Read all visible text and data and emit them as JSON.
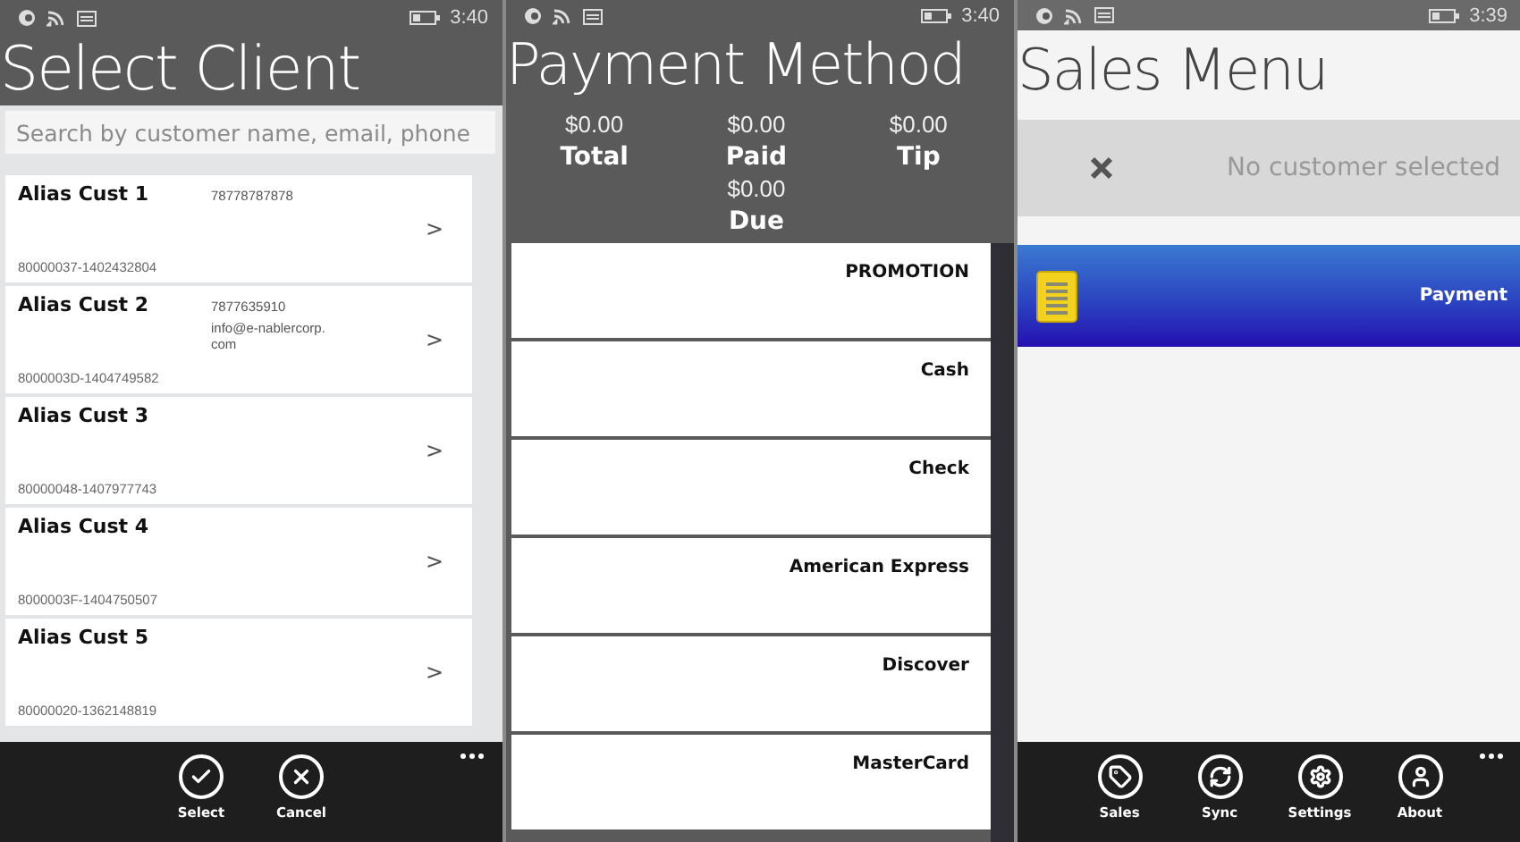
{
  "select_client": {
    "status_bar": {
      "time": "3:40"
    },
    "title": "Select Client",
    "search": {
      "placeholder": "Search by customer name, email, phone"
    },
    "clients": [
      {
        "name": "Alias Cust 1",
        "phone": "78778787878",
        "id": "80000037-1402432804",
        "arrow": ">"
      },
      {
        "name": "Alias Cust 2",
        "phone": "7877635910",
        "email": "info@e-nablercorp.com",
        "id": "8000003D-1404749582",
        "arrow": ">"
      },
      {
        "name": "Alias Cust 3",
        "id": "80000048-1407977743",
        "arrow": ">"
      },
      {
        "name": "Alias Cust 4",
        "id": "8000003F-1404750507",
        "arrow": ">"
      },
      {
        "name": "Alias Cust 5",
        "id": "80000020-1362148819",
        "arrow": ">"
      }
    ],
    "app_bar": [
      {
        "kind": "check",
        "label": "Select"
      },
      {
        "kind": "close",
        "label": "Cancel"
      }
    ]
  },
  "payment_method": {
    "status_bar": {
      "time": "3:40"
    },
    "title": "Payment Method",
    "totals": [
      {
        "amount": "$0.00",
        "label": "Total"
      },
      {
        "amount": "$0.00",
        "label": "Paid"
      },
      {
        "amount": "$0.00",
        "label": "Tip"
      },
      {
        "amount": "$0.00",
        "label": "Due"
      }
    ],
    "methods": [
      "PROMOTION",
      "Cash",
      "Check",
      "American Express",
      "Discover",
      "MasterCard"
    ]
  },
  "sales_menu": {
    "status_bar": {
      "time": "3:39"
    },
    "title": "Sales Menu",
    "customer": "No customer selected",
    "tiles": [
      {
        "label": "Payment"
      }
    ],
    "app_bar": [
      {
        "kind": "tag",
        "label": "Sales"
      },
      {
        "kind": "sync",
        "label": "Sync"
      },
      {
        "kind": "gear",
        "label": "Settings"
      },
      {
        "kind": "person",
        "label": "About"
      }
    ]
  }
}
